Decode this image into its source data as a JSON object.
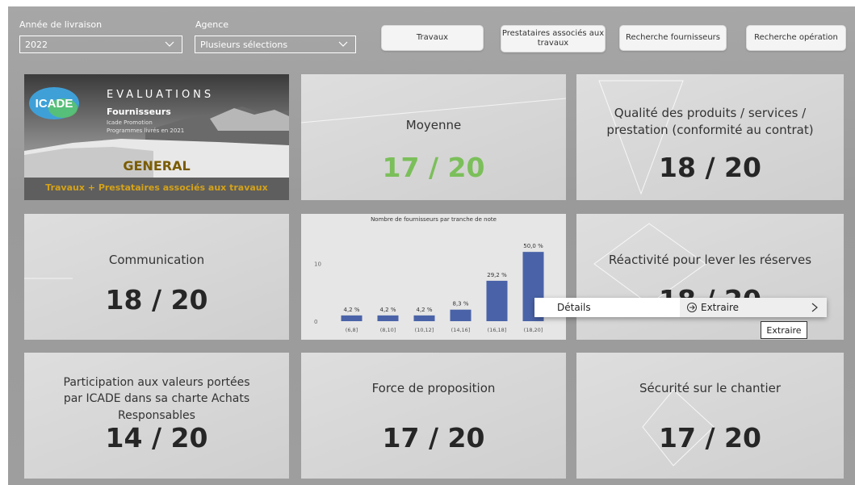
{
  "filters": {
    "year": {
      "label": "Année de livraison",
      "value": "2022"
    },
    "agency": {
      "label": "Agence",
      "value": "Plusieurs sélections"
    }
  },
  "buttons": {
    "travaux": "Travaux",
    "prestataires_line1": "Prestataires associés aux",
    "prestataires_line2": "travaux",
    "recherche_fournisseurs": "Recherche fournisseurs",
    "recherche_operation": "Recherche opération"
  },
  "banner": {
    "logo": "ICADE",
    "heading": "EVALUATIONS",
    "subheading": "Fournisseurs",
    "line1": "Icade Promotion",
    "line2": "Programmes livrés en 2021",
    "general": "GENERAL",
    "scope": "Travaux + Prestataires associés aux travaux"
  },
  "cards": {
    "moyenne": {
      "title": "Moyenne",
      "score": "17 / 20"
    },
    "qualite": {
      "title_line1": "Qualité des produits / services /",
      "title_line2": "prestation (conformité au contrat)",
      "score": "18 / 20"
    },
    "communication": {
      "title": "Communication",
      "score": "18 / 20"
    },
    "reactivite": {
      "title": "Réactivité pour lever les réserves",
      "score": "18 / 20"
    },
    "participation": {
      "title_line1": "Participation aux valeurs portées",
      "title_line2": "par ICADE dans sa charte Achats Responsables",
      "score": "14 / 20"
    },
    "force": {
      "title": "Force de proposition",
      "score": "17 / 20"
    },
    "securite": {
      "title": "Sécurité sur le chantier",
      "score": "17 / 20"
    }
  },
  "chart_data": {
    "type": "bar",
    "title": "Nombre de fournisseurs par tranche de note",
    "categories": [
      "(6,8]",
      "(8,10]",
      "(10,12]",
      "(14,16]",
      "(16,18]",
      "(18,20]"
    ],
    "values": [
      1,
      1,
      1,
      2,
      7,
      12
    ],
    "data_labels": [
      "4,2 %",
      "4,2 %",
      "4,2 %",
      "8,3 %",
      "29,2 %",
      "50,0 %"
    ],
    "ylim": [
      0,
      13
    ],
    "y_ticks": [
      "0",
      "10"
    ],
    "y_tick_values": [
      0,
      10
    ],
    "bar_color": "#4a63a8"
  },
  "context_menu": {
    "item": "Détails",
    "sub_item": "Extraire",
    "tooltip": "Extraire"
  },
  "colors": {
    "moyenne_score": "#7bbf5a",
    "general_text": "#7a5c00",
    "scope_text": "#d4a21a"
  }
}
